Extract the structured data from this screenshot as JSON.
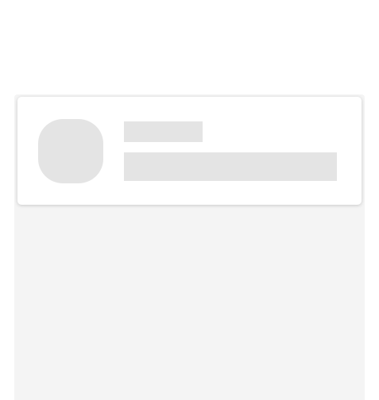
{
  "skeleton": {
    "placeholder_color": "#e4e4e4",
    "background_color": "#f4f4f4",
    "card_color": "#ffffff",
    "avatar_icon": "avatar-placeholder-icon"
  }
}
